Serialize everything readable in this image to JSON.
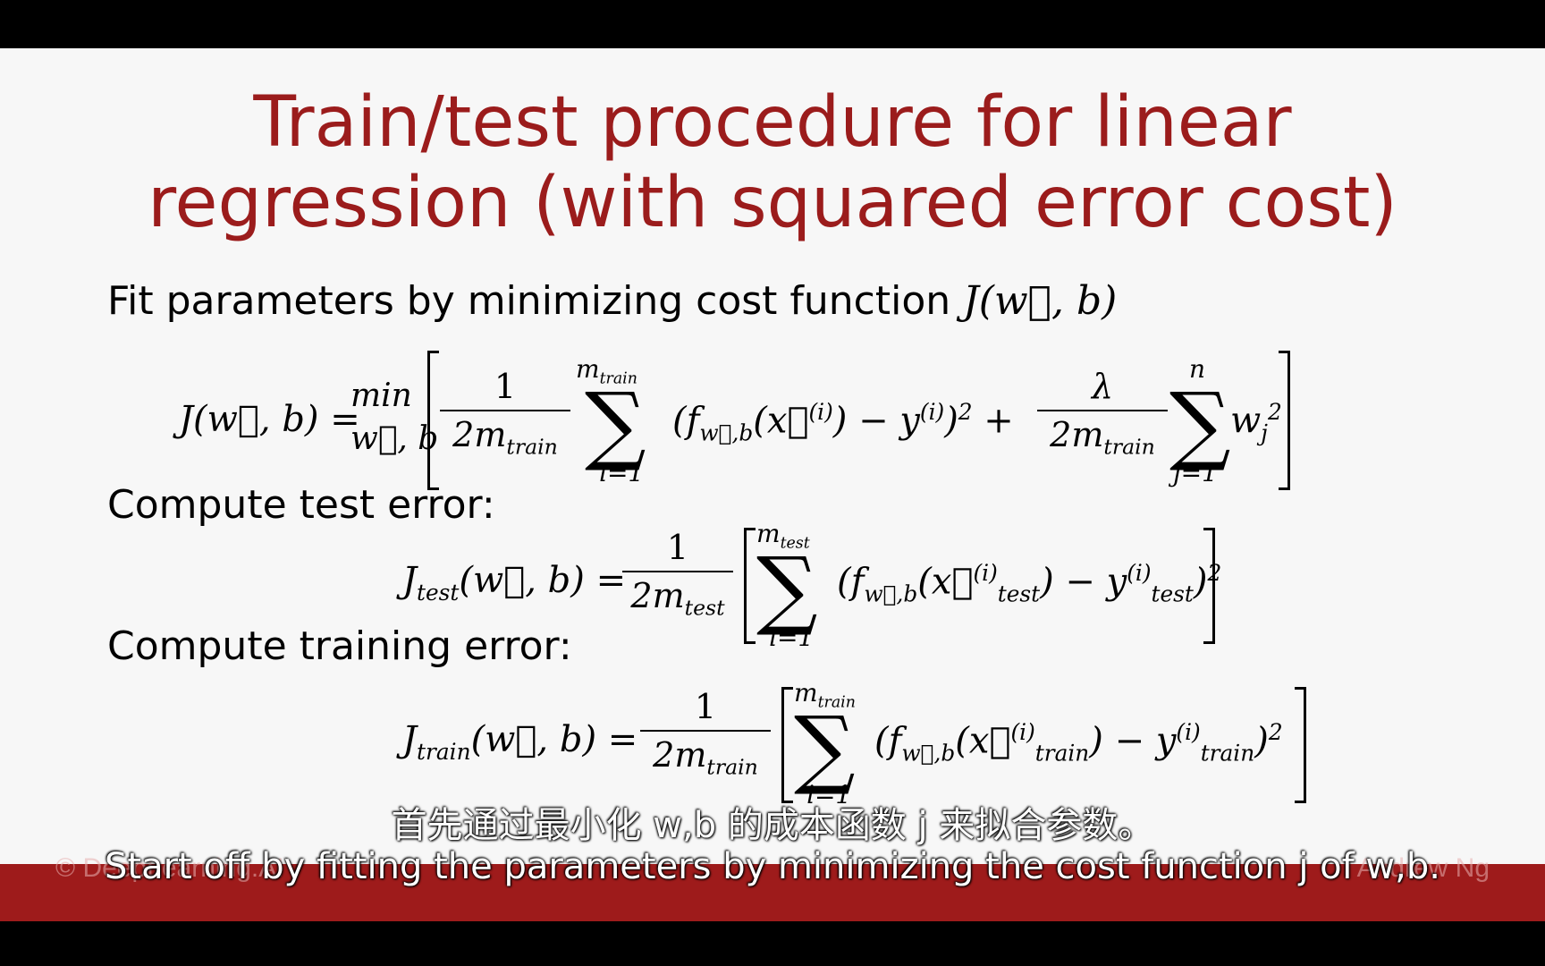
{
  "slide": {
    "title_line1": "Train/test procedure for linear",
    "title_line2": "regression (with squared error cost)",
    "fit_text": "Fit parameters by minimizing cost function",
    "fit_math": "J(w⃗, b)",
    "test_label": "Compute test error:",
    "train_label": "Compute training error:",
    "eq1": {
      "lhs": "J(w⃗, b) =",
      "min": "min",
      "min_under": "w⃗, b",
      "frac1_num": "1",
      "frac1_den": "2m",
      "frac1_den_sub": "train",
      "sum_top": "m",
      "sum_top_sub": "train",
      "sum_bottom": "i=1",
      "term": "(f",
      "term_sub": "w⃗,b",
      "term_rest": "(x⃗",
      "term_sup": "(i)",
      "minus": ") − y",
      "y_sup": "(i)",
      "close": ")",
      "sq": "2",
      "plus": "+",
      "frac2_num": "λ",
      "frac2_den": "2m",
      "frac2_den_sub": "train",
      "sum2_top": "n",
      "sum2_bottom": "j=1",
      "w": "w",
      "w_sub": "j",
      "w_sup": "2"
    },
    "eq2": {
      "lhs": "J",
      "lhs_sub": "test",
      "lhs_rest": "(w⃗, b) =",
      "frac_num": "1",
      "frac_den": "2m",
      "frac_den_sub": "test",
      "sum_top": "m",
      "sum_top_sub": "test",
      "sum_bottom": "i=1",
      "body": "(f",
      "body_sub": "w⃗,b",
      "x": "(x⃗",
      "x_sup": "(i)",
      "x_sub": "test",
      "minus": ") − y",
      "y_sup": "(i)",
      "y_sub": "test",
      "close": ")",
      "sq": "2"
    },
    "eq3": {
      "lhs": "J",
      "lhs_sub": "train",
      "lhs_rest": "(w⃗, b) =",
      "frac_num": "1",
      "frac_den": "2m",
      "frac_den_sub": "train",
      "sum_top": "m",
      "sum_top_sub": "train",
      "sum_bottom": "i=1",
      "body": "(f",
      "body_sub": "w⃗,b",
      "x": "(x⃗",
      "x_sup": "(i)",
      "x_sub": "train",
      "minus": ") − y",
      "y_sup": "(i)",
      "y_sub": "train",
      "close": ")",
      "sq": "2"
    }
  },
  "banner": {
    "logo_left": "© DeepLearning.AI",
    "logo_right": "Andrew Ng"
  },
  "subtitles": {
    "zh": "首先通过最小化 w,b 的成本函数 j 来拟合参数。",
    "en": "Start off by fitting the parameters by minimizing the cost function j of w,b."
  },
  "colors": {
    "title": "#9b1c1c",
    "banner": "#9e1b1b"
  }
}
